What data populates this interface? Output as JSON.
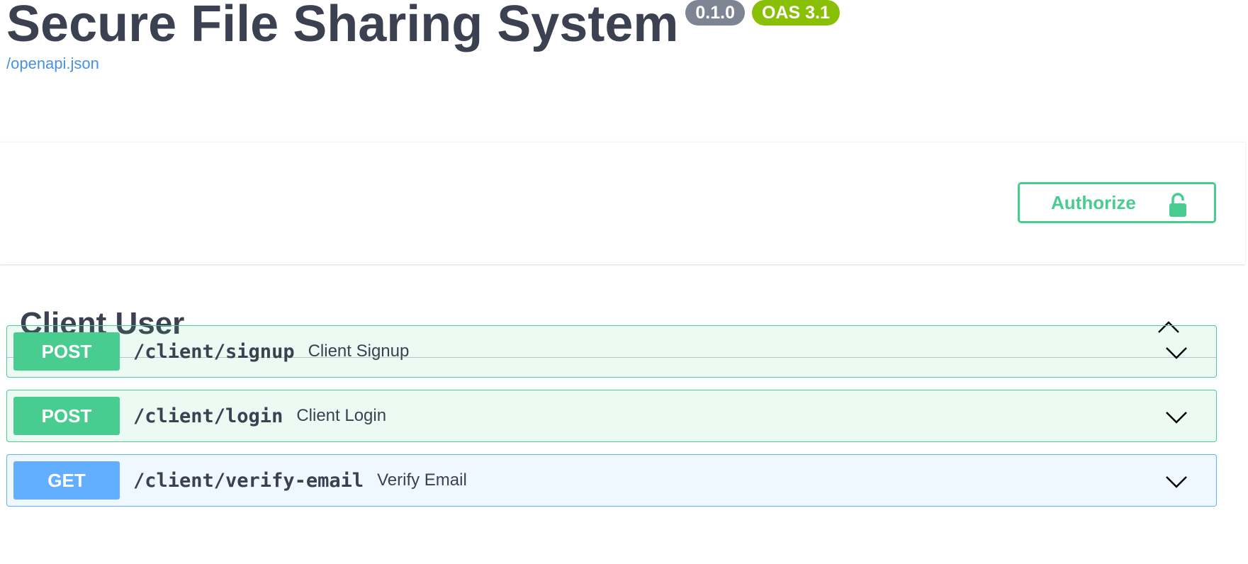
{
  "info": {
    "title": "Secure File Sharing System",
    "version": "0.1.0",
    "oas_version": "OAS 3.1",
    "spec_link": "/openapi.json"
  },
  "auth": {
    "authorize_label": "Authorize",
    "icon": "unlocked-lock-icon"
  },
  "tag": {
    "name": "Client User",
    "expanded": true,
    "operations": [
      {
        "method": "POST",
        "path": "/client/signup",
        "summary": "Client Signup"
      },
      {
        "method": "POST",
        "path": "/client/login",
        "summary": "Client Login"
      },
      {
        "method": "GET",
        "path": "/client/verify-email",
        "summary": "Verify Email"
      }
    ]
  },
  "colors": {
    "post": "#49cc90",
    "get": "#61affe",
    "version_badge": "#7d8492",
    "oas_badge": "#89bf04",
    "link": "#4990e2",
    "text": "#3b4151"
  }
}
